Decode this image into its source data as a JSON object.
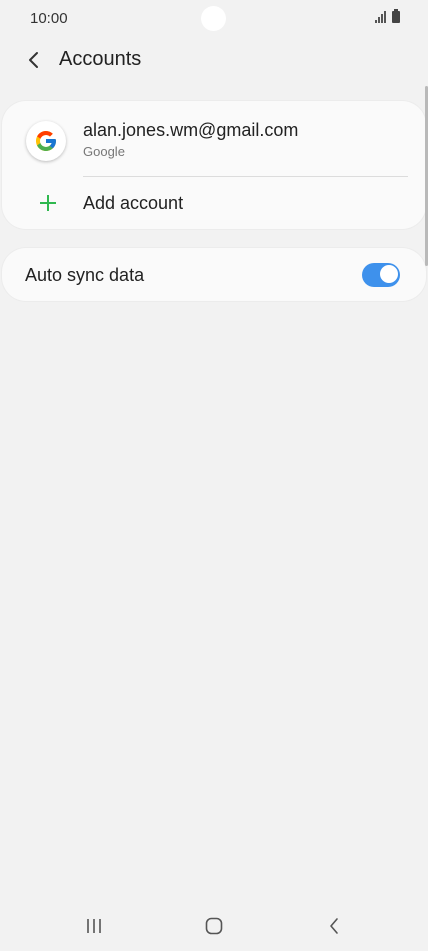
{
  "status_bar": {
    "time": "10:00"
  },
  "header": {
    "title": "Accounts"
  },
  "accounts": [
    {
      "email": "alan.jones.wm@gmail.com",
      "type": "Google"
    }
  ],
  "add_account": {
    "label": "Add account"
  },
  "auto_sync": {
    "label": "Auto sync data",
    "enabled": true
  },
  "colors": {
    "accent": "#3e91ec",
    "add_icon": "#2fb84f",
    "background": "#f2f2f2",
    "card": "#fafafa"
  },
  "icons": [
    "back-arrow-icon",
    "google-icon",
    "plus-icon",
    "toggle-on",
    "recents-icon",
    "home-icon",
    "nav-back-icon"
  ]
}
